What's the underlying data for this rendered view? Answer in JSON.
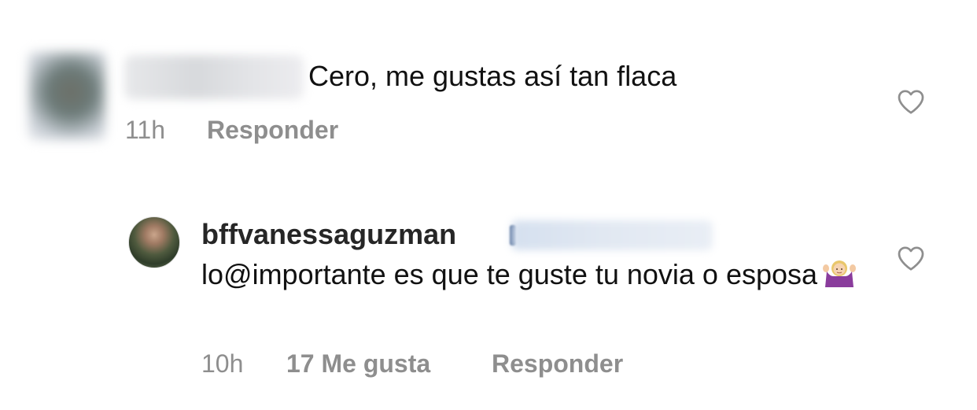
{
  "comments": [
    {
      "avatar_label": "blurred-avatar",
      "text": "Cero, me gustas así tan flaca",
      "time": "11h",
      "reply_label": "Responder"
    },
    {
      "username": "bffvanessaguzman",
      "text": "lo@importante es que te guste tu novia o esposa",
      "emoji": "🤷🏼‍♀️",
      "time": "10h",
      "likes_label": "17 Me gusta",
      "reply_label": "Responder"
    }
  ],
  "colors": {
    "text": "#111111",
    "meta": "#8e8e8e",
    "username": "#262626",
    "icon": "#8e8e8e"
  },
  "icons": {
    "like": "heart-outline-icon"
  }
}
